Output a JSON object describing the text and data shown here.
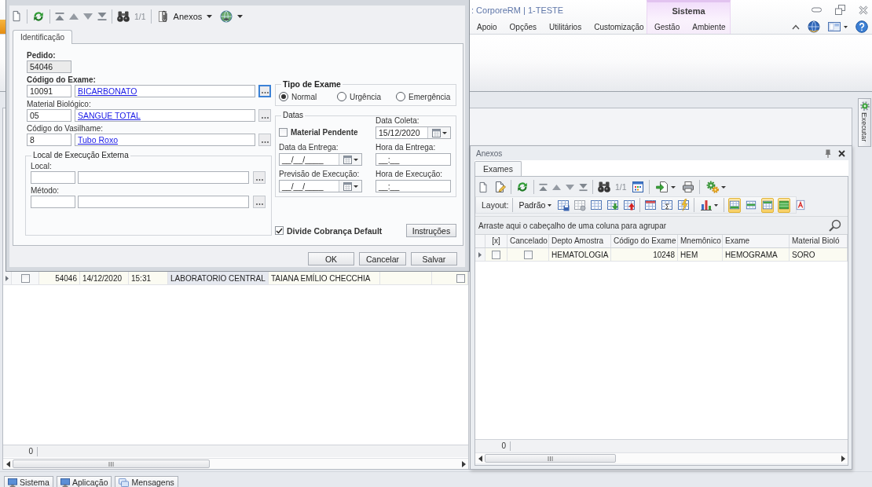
{
  "app": {
    "title": ": CorporeRM | 1-TESTE",
    "context_group": {
      "label": "Sistema",
      "tabs": [
        {
          "label": "Gestão",
          "selected": false
        },
        {
          "label": "Ambiente",
          "selected": false
        }
      ]
    },
    "ribbon_tabs": [
      {
        "label": "Apoio",
        "selected": false
      },
      {
        "label": "Opções",
        "selected": false
      },
      {
        "label": "Utilitários",
        "selected": false
      },
      {
        "label": "Customização",
        "selected": false
      }
    ],
    "side_tab": "Executar"
  },
  "main_grid": {
    "rows": [
      {
        "checked": false,
        "cells": [
          {
            "text": "54046",
            "focused": false
          },
          {
            "text": "14/12/2020",
            "focused": false
          },
          {
            "text": "15:31",
            "focused": false
          },
          {
            "text": "LABORATORIO CENTRAL",
            "focused": true
          },
          {
            "text": "TAIANA EMÍLIO CHECCHIA",
            "focused": false
          }
        ],
        "flag_checked": false
      }
    ],
    "footer": "0"
  },
  "status_tabs": [
    {
      "label": "Sistema",
      "kind": "screen"
    },
    {
      "label": "Aplicação",
      "kind": "screen"
    },
    {
      "label": "Mensagens",
      "kind": "messages"
    }
  ],
  "dialog": {
    "toolbar": {
      "record_counter": "1/1",
      "attachments_button": "Anexos"
    },
    "tabs": [
      {
        "label": "Identificação",
        "selected": true
      }
    ],
    "order": {
      "label": "Pedido:",
      "value": "54046",
      "disabled": true
    },
    "lookups": [
      {
        "label": "Código do Exame:",
        "code": "10091",
        "description": "BICARBONATO",
        "required": true,
        "focused": true
      },
      {
        "label": "Material Biológico:",
        "code": "05",
        "description": "SANGUE TOTAL",
        "required": false,
        "focused": false
      },
      {
        "label": "Código do Vasilhame:",
        "code": "8",
        "description": "Tubo Roxo",
        "required": false,
        "focused": false
      }
    ],
    "external": {
      "title": "Local de Execução Externa",
      "fields": [
        {
          "label": "Local:"
        },
        {
          "label": "Método:"
        }
      ]
    },
    "exam_type": {
      "title": "Tipo de Exame",
      "options": [
        {
          "label": "Normal",
          "selected": true
        },
        {
          "label": "Urgência",
          "selected": false
        },
        {
          "label": "Emergência",
          "selected": false
        }
      ]
    },
    "dates": {
      "title": "Datas",
      "pending": {
        "label": "Material Pendente",
        "checked": false
      },
      "fields": [
        {
          "label": "Data Coleta:",
          "value": "15/12/2020",
          "kind": "date"
        },
        {
          "label": "Data da Entrega:",
          "value": "__/__/____",
          "kind": "date"
        },
        {
          "label": "Hora da Entrega:",
          "value": "__:__",
          "kind": "time"
        },
        {
          "label": "Previsão de Execução:",
          "value": "__/__/____",
          "kind": "date"
        },
        {
          "label": "Hora de Execução:",
          "value": "__:__",
          "kind": "time"
        }
      ]
    },
    "split_billing": {
      "label": "Divide Cobrança Default",
      "checked": true
    },
    "instructions_button": "Instruções",
    "buttons": [
      "OK",
      "Cancelar",
      "Salvar"
    ]
  },
  "attachments_panel": {
    "title": "Anexos",
    "tabs": [
      {
        "label": "Exames",
        "selected": true
      }
    ],
    "record_counter": "1/1",
    "layout_label": "Layout:",
    "layout_button": "Padrão",
    "view_toggles": [
      {
        "on": true
      },
      {
        "on": false
      },
      {
        "on": true
      },
      {
        "on": true
      },
      {
        "on": false
      }
    ],
    "group_hint": "Arraste aqui o cabeçalho de uma coluna para agrupar",
    "columns": [
      "[x]",
      "Cancelado",
      "Depto Amostra",
      "Código do Exame",
      "Mnemônico",
      "Exame",
      "Material Bioló"
    ],
    "rows": [
      {
        "cells": [
          {
            "kind": "check",
            "checked": false
          },
          {
            "kind": "check",
            "checked": false
          },
          {
            "kind": "text",
            "text": "HEMATOLOGIA"
          },
          {
            "kind": "text",
            "text": "10248"
          },
          {
            "kind": "text",
            "text": "HEM"
          },
          {
            "kind": "text",
            "text": "HEMOGRAMA"
          },
          {
            "kind": "text",
            "text": "SORO"
          }
        ]
      }
    ],
    "footer": "0"
  }
}
